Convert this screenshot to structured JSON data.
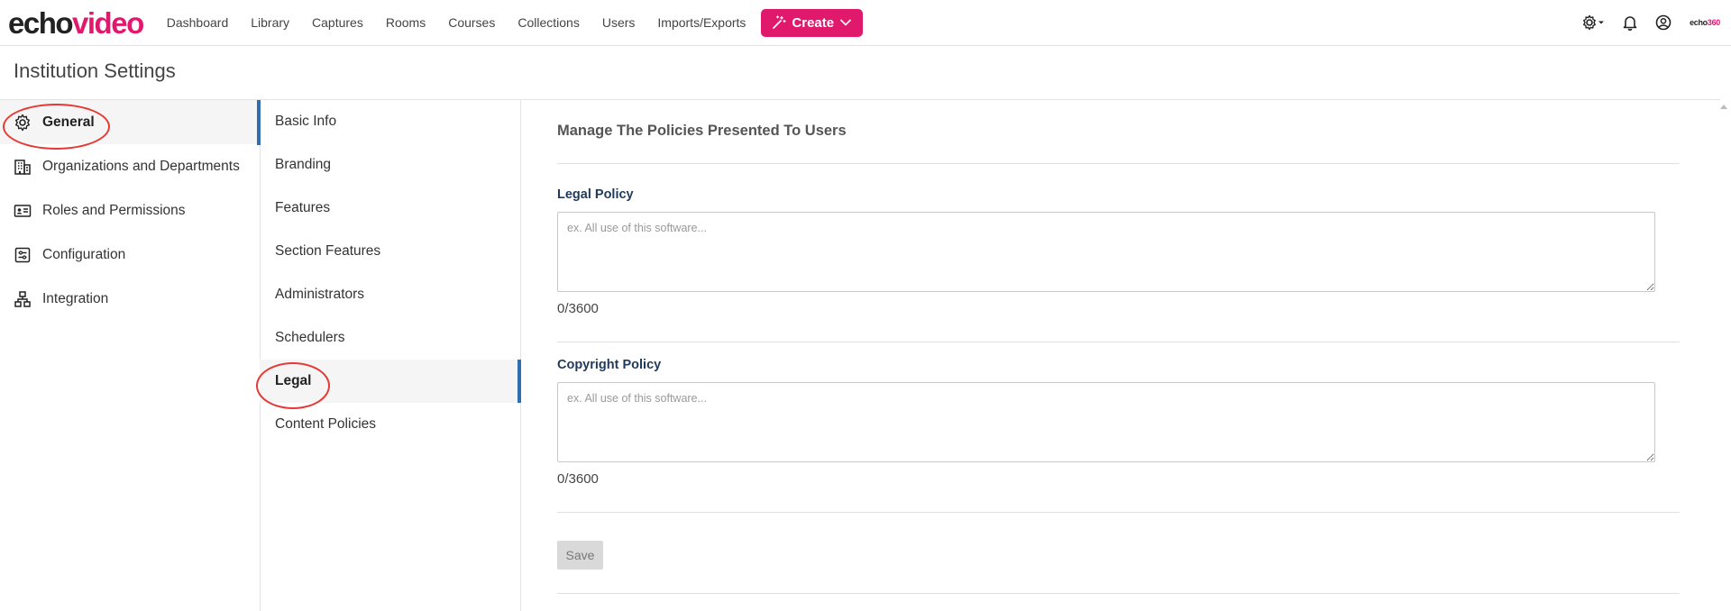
{
  "brand": {
    "logo_part1": "echo",
    "logo_part2": "video",
    "mini_part1": "echo",
    "mini_part2": "360"
  },
  "nav": {
    "items": [
      "Dashboard",
      "Library",
      "Captures",
      "Rooms",
      "Courses",
      "Collections",
      "Users",
      "Imports/Exports"
    ],
    "create_label": "Create"
  },
  "header": {
    "icons": [
      "settings-gear-icon",
      "bell-icon",
      "user-circle-icon"
    ]
  },
  "page": {
    "title": "Institution Settings"
  },
  "sidebar": {
    "items": [
      {
        "label": "General",
        "icon": "gear-icon",
        "active": true
      },
      {
        "label": "Organizations and Departments",
        "icon": "building-icon",
        "active": false
      },
      {
        "label": "Roles and Permissions",
        "icon": "id-card-icon",
        "active": false
      },
      {
        "label": "Configuration",
        "icon": "sliders-icon",
        "active": false
      },
      {
        "label": "Integration",
        "icon": "network-icon",
        "active": false
      }
    ]
  },
  "subnav": {
    "items": [
      {
        "label": "Basic Info",
        "active": false
      },
      {
        "label": "Branding",
        "active": false
      },
      {
        "label": "Features",
        "active": false
      },
      {
        "label": "Section Features",
        "active": false
      },
      {
        "label": "Administrators",
        "active": false
      },
      {
        "label": "Schedulers",
        "active": false
      },
      {
        "label": "Legal",
        "active": true
      },
      {
        "label": "Content Policies",
        "active": false
      }
    ]
  },
  "main": {
    "heading": "Manage The Policies Presented To Users",
    "legal": {
      "label": "Legal Policy",
      "placeholder": "ex. All use of this software...",
      "value": "",
      "counter": "0/3600"
    },
    "copyright": {
      "label": "Copyright Policy",
      "placeholder": "ex. All use of this software...",
      "value": "",
      "counter": "0/3600"
    },
    "save_label": "Save"
  },
  "colors": {
    "brand_pink": "#e0196d",
    "accent_blue": "#2f6fb0",
    "annotation_red": "#e53935"
  }
}
